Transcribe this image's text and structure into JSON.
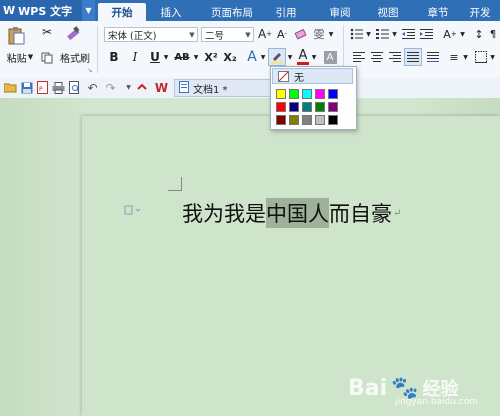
{
  "app": {
    "title": "WPS 文字"
  },
  "tabs": [
    {
      "label": "开始"
    },
    {
      "label": "插入"
    },
    {
      "label": "页面布局"
    },
    {
      "label": "引用"
    },
    {
      "label": "审阅"
    },
    {
      "label": "视图"
    },
    {
      "label": "章节"
    },
    {
      "label": "开发"
    }
  ],
  "ribbon": {
    "paste_label": "粘贴",
    "format_painter_label": "格式刷",
    "font_name": "宋体 (正文)",
    "font_size": "二号",
    "bold": "B",
    "italic": "I",
    "underline": "U",
    "strike": "AB",
    "superscript": "X²",
    "subscript": "X₂"
  },
  "document": {
    "tab_label": "文档1 *",
    "text_before": "我为我是",
    "text_highlighted": "中国人",
    "text_after": "而自豪",
    "paragraph_mark": "↵"
  },
  "color_menu": {
    "none_label": "无",
    "swatches": [
      "#ffff00",
      "#00ff00",
      "#00ffff",
      "#ff00ff",
      "#0000ff",
      "#ff0000",
      "#000080",
      "#008080",
      "#008000",
      "#800080",
      "#800000",
      "#808000",
      "#808080",
      "#c0c0c0",
      "#000000"
    ]
  },
  "watermark": {
    "brand": "Bai",
    "suffix": "经验",
    "sub": "jingyan.baidu.com"
  }
}
